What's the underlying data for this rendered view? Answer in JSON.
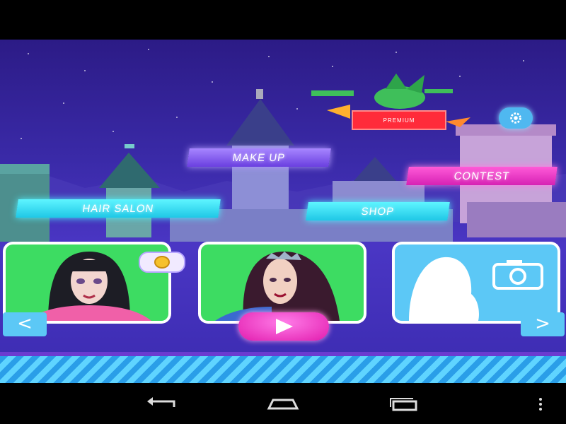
{
  "menu": {
    "hair_salon": "HAIR SALON",
    "make_up": "MAKE UP",
    "shop": "SHOP",
    "contest": "CONTEST",
    "premium": "PREMIUM"
  },
  "carousel": {
    "prev_label": "<",
    "next_label": ">"
  },
  "colors": {
    "cyan": "#4ff0ff",
    "purple": "#8a66ff",
    "pink": "#ff3fd0",
    "green_card": "#3ddc62",
    "blue_card": "#5cc8f6",
    "water": "#2a9ee8"
  },
  "icons": {
    "settings": "gear-icon",
    "camera": "camera-icon",
    "play": "play-icon",
    "coin": "coin-icon",
    "back": "back-icon",
    "home": "home-icon",
    "recents": "recents-icon",
    "more": "more-vert-icon"
  }
}
